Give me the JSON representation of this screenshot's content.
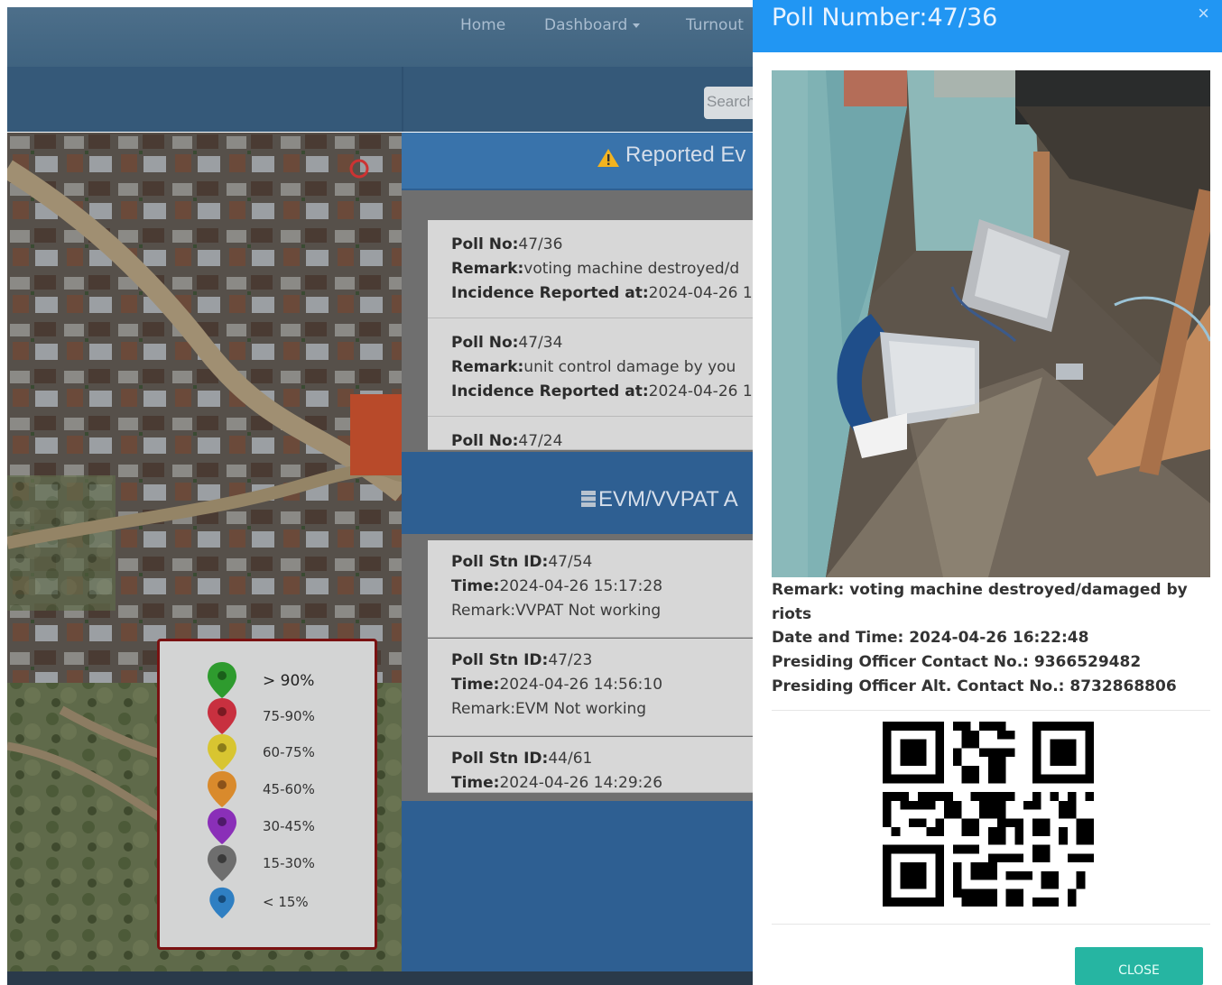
{
  "nav": {
    "home": "Home",
    "dashboard": "Dashboard",
    "turnout": "Turnout"
  },
  "search": {
    "placeholder": "Search"
  },
  "reported_events": {
    "title": "Reported Ev",
    "items": [
      {
        "poll_label": "Poll No:",
        "poll": "47/36",
        "remark_label": "Remark:",
        "remark": "voting machine destroyed/d",
        "time_label": "Incidence Reported at:",
        "time": "2024-04-26 1"
      },
      {
        "poll_label": "Poll No:",
        "poll": "47/34",
        "remark_label": "Remark:",
        "remark": "unit control damage by you",
        "time_label": "Incidence Reported at:",
        "time": "2024-04-26 1"
      },
      {
        "poll_label": "Poll No:",
        "poll": "47/24"
      }
    ]
  },
  "evm": {
    "title": "EVM/VVPAT A",
    "items": [
      {
        "id_label": "Poll Stn ID:",
        "id": "47/54",
        "time_label": "Time:",
        "time": "2024-04-26 15:17:28",
        "remark": "Remark:VVPAT Not working"
      },
      {
        "id_label": "Poll Stn ID:",
        "id": "47/23",
        "time_label": "Time:",
        "time": "2024-04-26 14:56:10",
        "remark": "Remark:EVM Not working"
      },
      {
        "id_label": "Poll Stn ID:",
        "id": "44/61",
        "time_label": "Time:",
        "time": "2024-04-26 14:29:26"
      }
    ]
  },
  "legend": [
    {
      "label": "> 90%",
      "color": "#2e9b2e"
    },
    {
      "label": "75-90%",
      "color": "#c8303f"
    },
    {
      "label": "60-75%",
      "color": "#d8c531"
    },
    {
      "label": "45-60%",
      "color": "#d98a2c"
    },
    {
      "label": "30-45%",
      "color": "#8a2fb8"
    },
    {
      "label": "15-30%",
      "color": "#6e6e6e"
    },
    {
      "label": "< 15%",
      "color": "#2f7fc2"
    }
  ],
  "modal": {
    "title": "Poll Number:47/36",
    "close_x": "×",
    "remark": "Remark: voting machine destroyed/damaged by",
    "remark_cont": "riots",
    "datetime": "Date and Time: 2024-04-26 16:22:48",
    "contact": "Presiding Officer Contact No.: 9366529482",
    "alt_contact": "Presiding Officer Alt. Contact No.: 8732868806",
    "close_button": "CLOSE"
  },
  "colors": {
    "modal_header": "#2196f3",
    "close_button": "#26b5a2",
    "panel_blue": "#2e5f92"
  }
}
